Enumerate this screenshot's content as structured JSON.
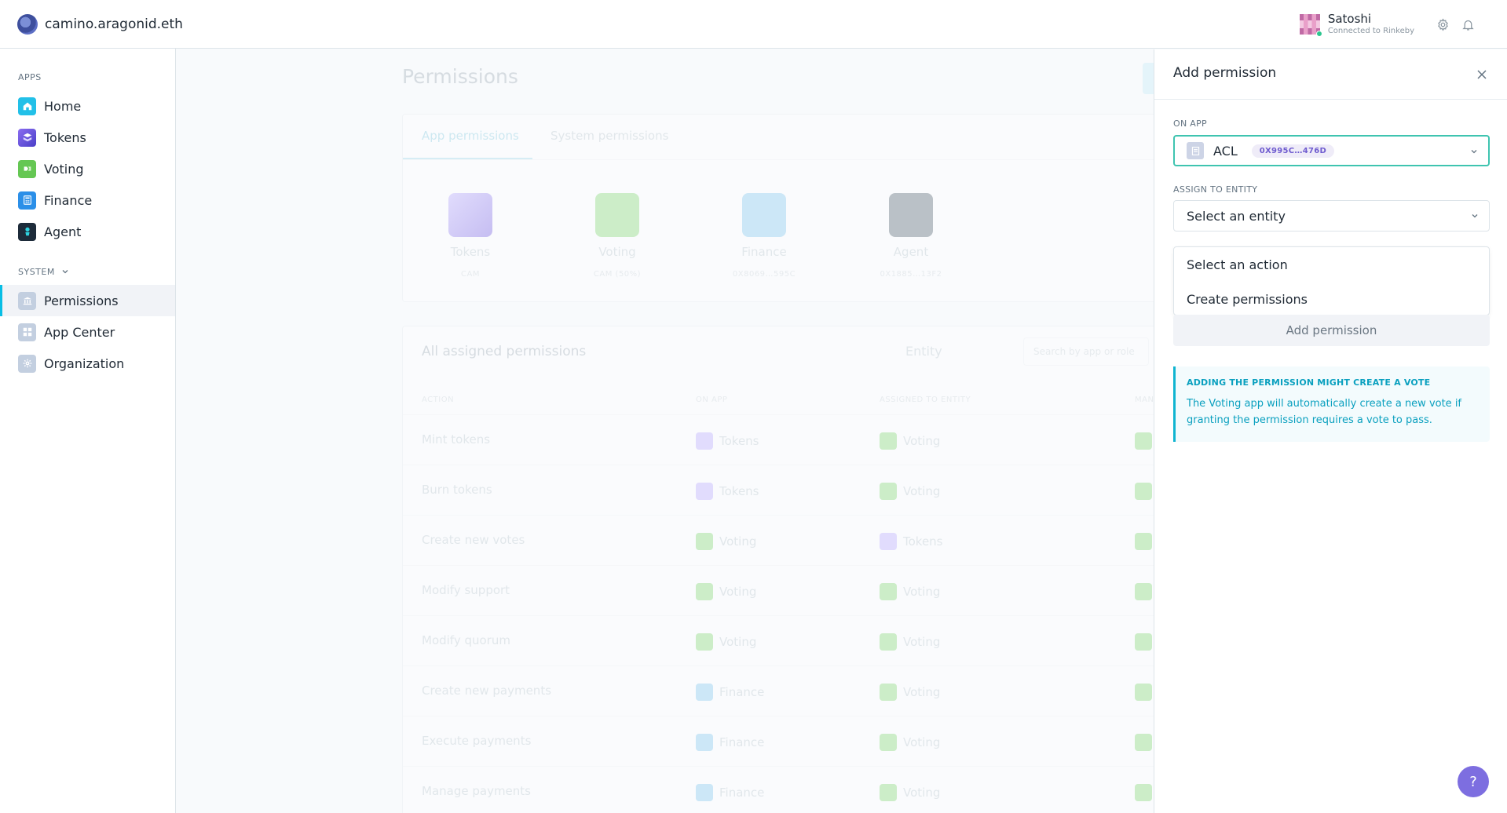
{
  "header": {
    "org_name": "camino.aragonid.eth",
    "user_name": "Satoshi",
    "network": "Connected to Rinkeby",
    "icons": [
      "settings-icon",
      "notifications-icon"
    ]
  },
  "sidebar": {
    "apps_heading": "APPS",
    "system_heading": "SYSTEM",
    "apps": [
      {
        "label": "Home",
        "icon": "home-icon",
        "color": "#22c0e8"
      },
      {
        "label": "Tokens",
        "icon": "tokens-icon",
        "color": "#6a4fe0"
      },
      {
        "label": "Voting",
        "icon": "voting-icon",
        "color": "#65c753"
      },
      {
        "label": "Finance",
        "icon": "finance-icon",
        "color": "#2b8fe8"
      },
      {
        "label": "Agent",
        "icon": "agent-icon",
        "color": "#1d2b3a"
      }
    ],
    "system": [
      {
        "label": "Permissions",
        "icon": "permissions-icon",
        "active": true
      },
      {
        "label": "App Center",
        "icon": "app-center-icon"
      },
      {
        "label": "Organization",
        "icon": "organization-icon"
      }
    ]
  },
  "main": {
    "title": "Permissions",
    "tabs": [
      "App permissions",
      "System permissions"
    ],
    "apps": [
      {
        "name": "Tokens",
        "sub": "CAM"
      },
      {
        "name": "Voting",
        "sub": "CAM (50%)"
      },
      {
        "name": "Finance",
        "sub": "0X8069…595C"
      },
      {
        "name": "Agent",
        "sub": "0X1885…13F2"
      }
    ],
    "table": {
      "title": "All assigned permissions",
      "filter_label": "Entity",
      "search_placeholder": "Search by app or role",
      "headers": [
        "ACTION",
        "ON APP",
        "ASSIGNED TO ENTITY",
        "MAN"
      ],
      "rows": [
        {
          "action": "Mint tokens",
          "app": "Tokens",
          "entity": "Voting"
        },
        {
          "action": "Burn tokens",
          "app": "Tokens",
          "entity": "Voting"
        },
        {
          "action": "Create new votes",
          "app": "Voting",
          "entity": "Tokens"
        },
        {
          "action": "Modify support",
          "app": "Voting",
          "entity": "Voting"
        },
        {
          "action": "Modify quorum",
          "app": "Voting",
          "entity": "Voting"
        },
        {
          "action": "Create new payments",
          "app": "Finance",
          "entity": "Voting"
        },
        {
          "action": "Execute payments",
          "app": "Finance",
          "entity": "Voting"
        },
        {
          "action": "Manage payments",
          "app": "Finance",
          "entity": "Voting"
        }
      ]
    }
  },
  "panel": {
    "title": "Add permission",
    "on_app_label": "ON APP",
    "on_app_value": "ACL",
    "on_app_address": "0X995C…476D",
    "entity_label": "ASSIGN TO ENTITY",
    "entity_placeholder": "Select an entity",
    "action_options": [
      "Select an action",
      "Create permissions"
    ],
    "submit_label": "Add permission",
    "info_title": "ADDING THE PERMISSION MIGHT CREATE A VOTE",
    "info_text": "The Voting app will automatically create a new vote if granting the permission requires a vote to pass.",
    "help_label": "?"
  }
}
